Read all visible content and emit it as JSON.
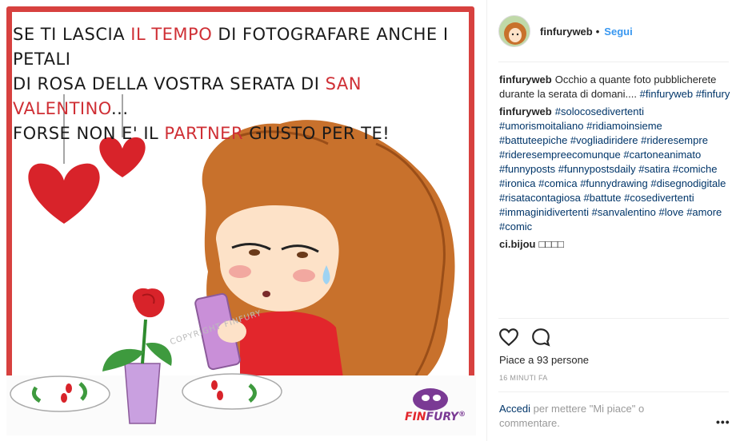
{
  "post": {
    "comic_line_1a": "Se ti lascia ",
    "comic_line_1b": "il tempo",
    "comic_line_1c": " di fotografare anche i petali",
    "comic_line_2a": "di rosa della vostra serata di ",
    "comic_line_2b": "San Valentino",
    "comic_line_2c": "...",
    "comic_line_3a": "forse non e' il ",
    "comic_line_3b": "partner",
    "comic_line_3c": " giusto per te!",
    "watermark": "COPYRIGHT FINFURY",
    "logo_text_a": "FIN",
    "logo_text_b": "FURY",
    "logo_mark": "®"
  },
  "header": {
    "username": "finfuryweb",
    "dot": "•",
    "follow_label": "Segui"
  },
  "comments": [
    {
      "author": "finfuryweb",
      "text": "Occhio a quante foto pubblicherete durante la serata di domani.... ",
      "tags": [
        "#finfuryweb",
        "#finfury"
      ]
    },
    {
      "author": "finfuryweb",
      "text": "",
      "tags": [
        "#solocosedivertenti",
        "#umorismoitaliano",
        "#ridiamoinsieme",
        "#battuteepiche",
        "#vogliadiridere",
        "#rideresempre",
        "#rideresempreecomunque",
        "#cartoneanimato",
        "#funnyposts",
        "#funnypostsdaily",
        "#satira",
        "#comiche",
        "#ironica",
        "#comica",
        "#funnydrawing",
        "#disegnodigitale",
        "#risatacontagiosa",
        "#battute",
        "#cosedivertenti",
        "#immaginidivertenti",
        "#sanvalentino",
        "#love",
        "#amore",
        "#comic"
      ]
    },
    {
      "author": "ci.bijou",
      "text": "□□□□",
      "tags": []
    }
  ],
  "actions": {
    "like_icon": "heart-outline-icon",
    "comment_icon": "comment-bubble-icon"
  },
  "likes_text": "Piace a 93 persone",
  "timestamp": "16 minuti fa",
  "login": {
    "link": "Accedi",
    "rest": " per mettere \"Mi piace\" o commentare."
  },
  "more_label": "•••",
  "colors": {
    "accent_red": "#d7413f",
    "follow_blue": "#3897f0",
    "hashtag": "#003569"
  }
}
